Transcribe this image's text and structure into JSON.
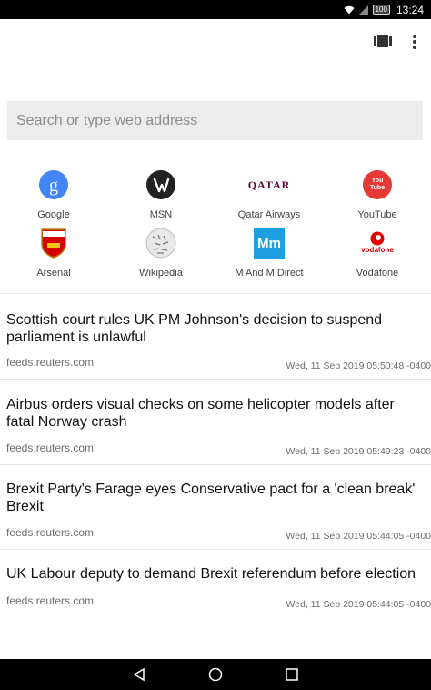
{
  "status_bar": {
    "time": "13:24",
    "battery": "100"
  },
  "search": {
    "placeholder": "Search or type web address"
  },
  "tiles": [
    {
      "label": "Google",
      "icon": "google-icon"
    },
    {
      "label": "MSN",
      "icon": "msn-icon"
    },
    {
      "label": "Qatar Airways",
      "icon": "qatar-airways-icon",
      "logo_text": "QATAR"
    },
    {
      "label": "YouTube",
      "icon": "youtube-icon",
      "logo_text": "You Tube"
    },
    {
      "label": "Arsenal",
      "icon": "arsenal-icon",
      "logo_text": "Arsenal"
    },
    {
      "label": "Wikipedia",
      "icon": "wikipedia-icon"
    },
    {
      "label": "M And M Direct",
      "icon": "m-and-m-direct-icon",
      "logo_text": "Mm"
    },
    {
      "label": "Vodafone",
      "icon": "vodafone-icon",
      "logo_text": "vodafone"
    }
  ],
  "articles": [
    {
      "headline": "Scottish court rules UK PM Johnson's decision to suspend parliament is unlawful",
      "source": "feeds.reuters.com",
      "date": "Wed, 11 Sep 2019 05:50:48 -0400"
    },
    {
      "headline": "Airbus orders visual checks on some helicopter models after fatal Norway crash",
      "source": "feeds.reuters.com",
      "date": "Wed, 11 Sep 2019 05:49:23 -0400"
    },
    {
      "headline": "Brexit Party's Farage eyes Conservative pact for a 'clean break' Brexit",
      "source": "feeds.reuters.com",
      "date": "Wed, 11 Sep 2019 05:44:05 -0400"
    },
    {
      "headline": "UK Labour deputy to demand Brexit referendum before election",
      "source": "feeds.reuters.com",
      "date": "Wed, 11 Sep 2019 05:44:05 -0400"
    }
  ],
  "colors": {
    "google_blue": "#4285f4",
    "youtube_red": "#e53935",
    "mm_blue": "#1e9fe0",
    "vodafone_red": "#e60000",
    "qatar_maroon": "#5c0632"
  }
}
